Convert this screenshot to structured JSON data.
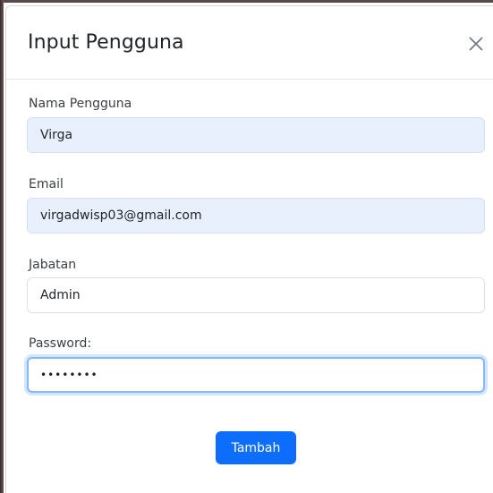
{
  "modal": {
    "title": "Input Pengguna",
    "close_icon": "close-icon"
  },
  "form": {
    "username": {
      "label": "Nama Pengguna",
      "value": "Virga"
    },
    "email": {
      "label": "Email",
      "value": "virgadwisp03@gmail.com"
    },
    "jabatan": {
      "label": "Jabatan",
      "value": "Admin"
    },
    "password": {
      "label": "Password:",
      "value": "secret12"
    },
    "submit_label": "Tambah"
  },
  "colors": {
    "primary": "#0d6efd",
    "autofill_bg": "#e8f0fe",
    "focus_ring": "#86b7fe"
  }
}
